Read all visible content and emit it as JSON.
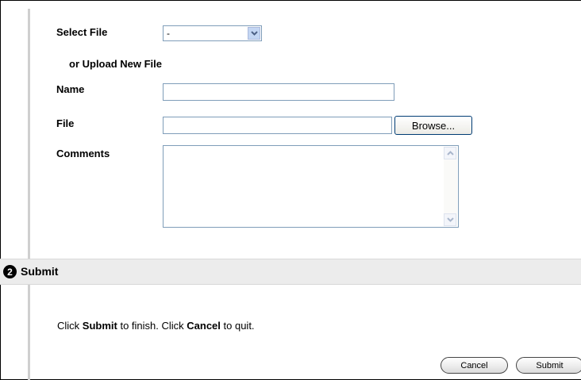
{
  "form": {
    "select_file_label": "Select File",
    "select_file_value": "-",
    "upload_new_label": "or Upload New File",
    "name_label": "Name",
    "name_value": "",
    "file_label": "File",
    "file_value": "",
    "browse_label": "Browse...",
    "comments_label": "Comments",
    "comments_value": ""
  },
  "section": {
    "step_number": "2",
    "title": "Submit"
  },
  "instructions": {
    "part1": "Click ",
    "submit_word": "Submit",
    "part2": " to finish. Click ",
    "cancel_word": "Cancel",
    "part3": " to quit."
  },
  "buttons": {
    "cancel": "Cancel",
    "submit": "Submit"
  }
}
